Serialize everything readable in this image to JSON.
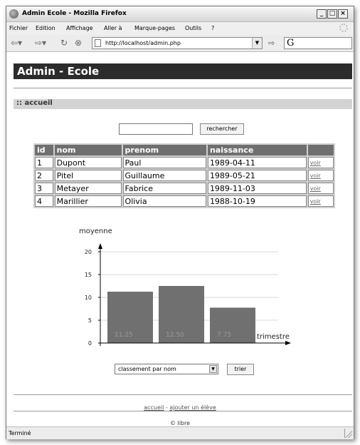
{
  "window": {
    "title": "Admin Ecole - Mozilla Firefox"
  },
  "menubar": {
    "items": [
      {
        "label": "Fichier"
      },
      {
        "label": "Edition"
      },
      {
        "label": "Affichage"
      },
      {
        "label": "Aller à"
      },
      {
        "label": "Marque-pages"
      },
      {
        "label": "Outils"
      },
      {
        "label": "?"
      }
    ]
  },
  "navbar": {
    "url": "http://localhost/admin.php",
    "search_engine_icon": "G"
  },
  "page": {
    "header": "Admin - Ecole",
    "section": ":: accueil",
    "search_button": "rechercher",
    "search_value": "",
    "table": {
      "headers": [
        "id",
        "nom",
        "prenom",
        "naissance",
        ""
      ],
      "rows": [
        [
          "1",
          "Dupont",
          "Paul",
          "1989-04-11",
          "voir"
        ],
        [
          "2",
          "Pitel",
          "Guillaume",
          "1989-05-21",
          "voir"
        ],
        [
          "3",
          "Metayer",
          "Fabrice",
          "1989-11-03",
          "voir"
        ],
        [
          "4",
          "Marillier",
          "Olivia",
          "1988-10-19",
          "voir"
        ]
      ]
    },
    "sort_select": "classement par nom",
    "sort_button": "trier",
    "footer_link_home": "accueil",
    "footer_separator": "-",
    "footer_link_add": "ajouter un élève",
    "copyright": "© libre"
  },
  "chart_data": {
    "type": "bar",
    "ylabel": "moyenne",
    "xlabel": "trimestre",
    "ylim": [
      0,
      20
    ],
    "yticks": [
      0,
      5,
      10,
      15,
      20
    ],
    "categories": [
      "",
      "",
      ""
    ],
    "values": [
      11.25,
      12.5,
      7.75
    ],
    "value_labels": [
      "11.25",
      "12.50",
      "7.75"
    ],
    "grid": true,
    "bar_color": "#707070"
  },
  "status": {
    "text": "Terminé"
  }
}
